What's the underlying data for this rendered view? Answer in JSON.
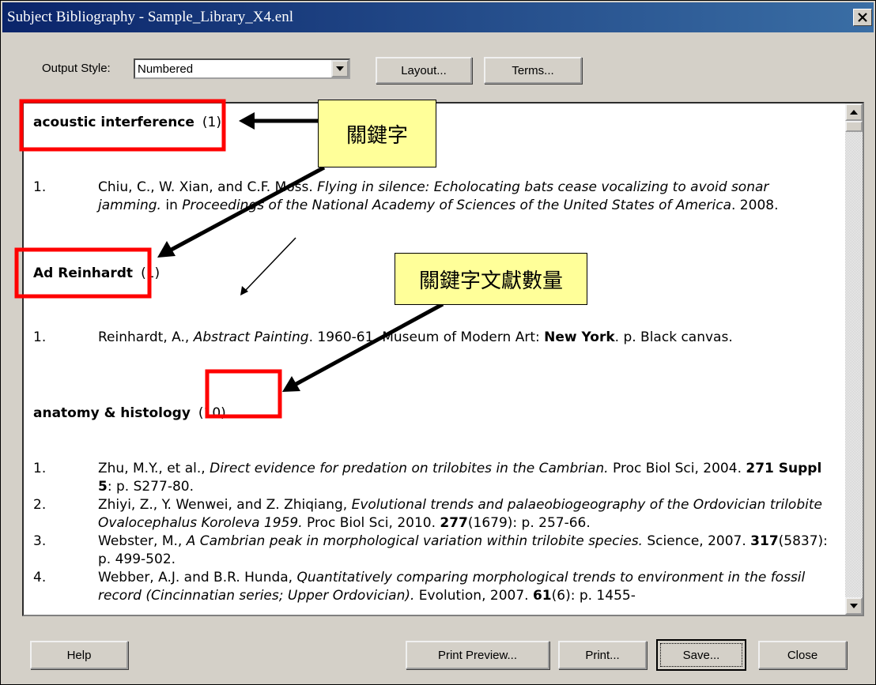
{
  "window": {
    "title": "Subject Bibliography - Sample_Library_X4.enl"
  },
  "toolbar": {
    "output_style_label": "Output Style:",
    "output_style_value": "Numbered",
    "layout_label": "Layout...",
    "terms_label": "Terms..."
  },
  "bibliography": {
    "groups": [
      {
        "term": "acoustic interference",
        "count": "(1)",
        "entries": [
          {
            "num": "1.",
            "html": "Chiu, C., W. Xian, and C.F. Moss. <i>Flying in silence: Echolocating bats cease vocalizing to avoid sonar jamming.</i> in <i>Proceedings of the National Academy of Sciences of the United States of America</i>. 2008."
          }
        ]
      },
      {
        "term": "Ad Reinhardt",
        "count": "(1)",
        "entries": [
          {
            "num": "1.",
            "html": "Reinhardt, A., <i>Abstract Painting</i>. 1960-61, Museum of Modern Art: <b>New York</b>. p. Black canvas."
          }
        ]
      },
      {
        "term": "anatomy & histology",
        "count": "(10)",
        "entries": [
          {
            "num": "1.",
            "html": "Zhu, M.Y., et al., <i>Direct evidence for predation on trilobites in the Cambrian.</i> Proc Biol Sci, 2004. <b>271 Suppl 5</b>: p. S277-80."
          },
          {
            "num": "2.",
            "html": "Zhiyi, Z., Y. Wenwei, and Z. Zhiqiang, <i>Evolutional trends and palaeobiogeography of the Ordovician trilobite Ovalocephalus Koroleva 1959.</i> Proc Biol Sci, 2010. <b>277</b>(1679): p. 257-66."
          },
          {
            "num": "3.",
            "html": "Webster, M., <i>A Cambrian peak in morphological variation within trilobite species.</i> Science, 2007. <b>317</b>(5837): p. 499-502."
          },
          {
            "num": "4.",
            "html": "Webber, A.J. and B.R. Hunda, <i>Quantitatively comparing morphological trends to environment in the fossil record (Cincinnatian series; Upper Ordovician).</i> Evolution, 2007. <b>61</b>(6): p. 1455-"
          }
        ]
      }
    ]
  },
  "annotations": {
    "keyword_label": "關鍵字",
    "count_label": "關鍵字文獻數量",
    "highlight_color": "#ff0000",
    "callout_color": "#ffff99"
  },
  "footer": {
    "help": "Help",
    "print_preview": "Print Preview...",
    "print": "Print...",
    "save": "Save...",
    "close": "Close"
  }
}
